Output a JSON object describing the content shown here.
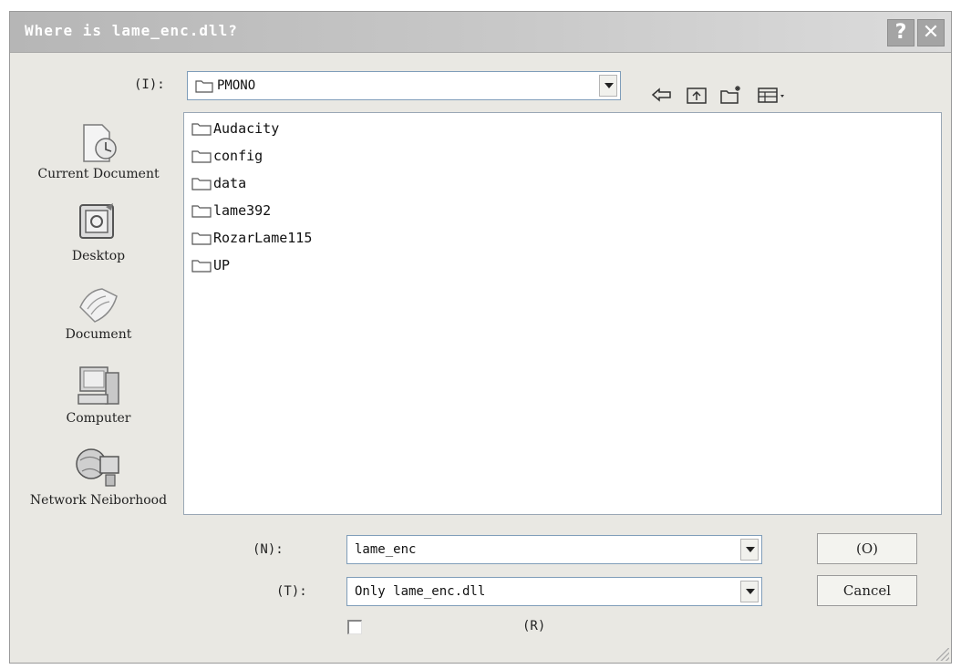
{
  "window": {
    "title": "Where is lame_enc.dll?",
    "help_glyph": "?",
    "close_glyph": "✕"
  },
  "lookin": {
    "label": "(I):",
    "value": "PMONO"
  },
  "toolbar": {
    "icons": [
      "back-icon",
      "up-folder-icon",
      "new-folder-icon",
      "view-menu-icon"
    ]
  },
  "places": [
    {
      "label": "Current Document",
      "icon": "recent-documents-icon"
    },
    {
      "label": "Desktop",
      "icon": "desktop-icon"
    },
    {
      "label": "Document",
      "icon": "my-documents-icon"
    },
    {
      "label": "Computer",
      "icon": "computer-icon"
    },
    {
      "label": "Network Neiborhood",
      "icon": "network-icon"
    }
  ],
  "files": [
    {
      "name": "Audacity"
    },
    {
      "name": "config"
    },
    {
      "name": "data"
    },
    {
      "name": "lame392"
    },
    {
      "name": "RozarLame115"
    },
    {
      "name": "UP"
    }
  ],
  "filename": {
    "label": "(N):",
    "value": "lame_enc"
  },
  "filetype": {
    "label": "(T):",
    "value": "Only lame_enc.dll"
  },
  "readonly": {
    "label": "(R)",
    "checked": false
  },
  "buttons": {
    "open": "(O)",
    "cancel": "Cancel"
  },
  "colors": {
    "folder_outline": "#555555",
    "field_border": "#7f9db9",
    "dialog_bg": "#e9e8e3"
  }
}
